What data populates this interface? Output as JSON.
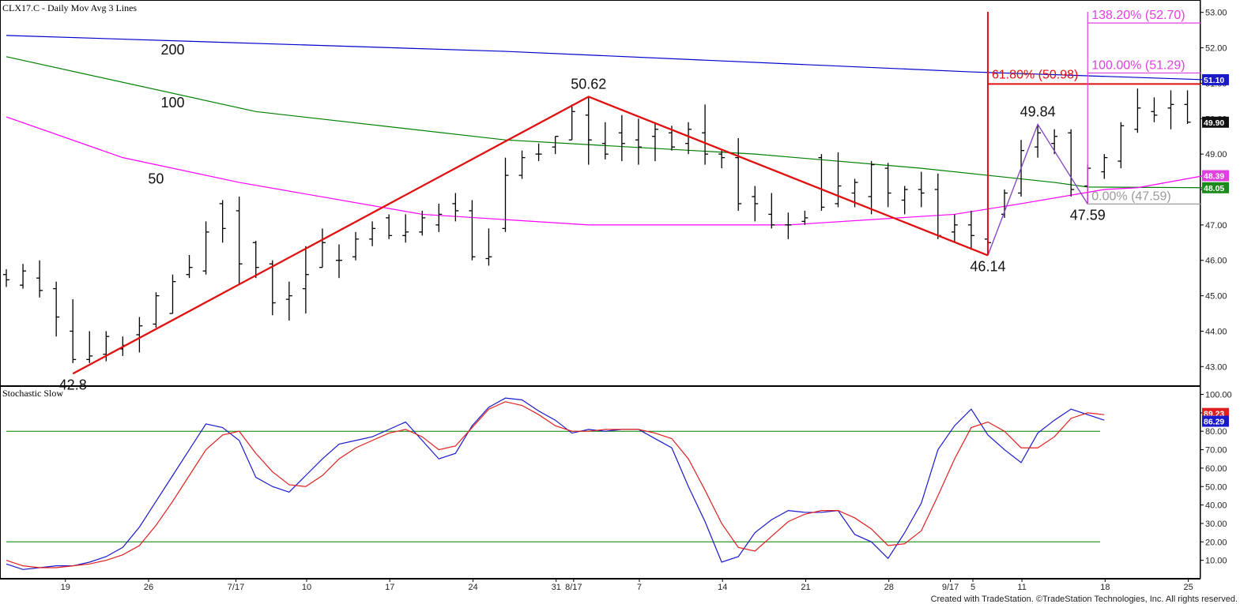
{
  "header": {
    "symbol_title": "CLX17.C - Daily  Mov Avg 3 Lines",
    "stoch_title": "Stochastic Slow",
    "credit": "Created with TradeStation. ©TradeStation Technologies, Inc. All rights reserved."
  },
  "chart_data": [
    {
      "type": "ohlc",
      "title": "CLX17.C - Daily  Mov Avg 3 Lines",
      "y_ticks": [
        "53.00",
        "52.00",
        "51.00",
        "50.00",
        "49.00",
        "48.00",
        "47.00",
        "46.00",
        "45.00",
        "44.00",
        "43.00"
      ],
      "ylim": [
        42.45,
        53.35
      ],
      "x_ticks": [
        "19",
        "26",
        "7/17",
        "10",
        "17",
        "24",
        "31",
        "8/17",
        "7",
        "14",
        "21",
        "28",
        "9/17",
        "5",
        "11",
        "18",
        "25"
      ],
      "bars": [
        {
          "h": 45.75,
          "l": 45.25,
          "o": 45.6,
          "c": 45.45
        },
        {
          "h": 45.9,
          "l": 45.2,
          "o": 45.3,
          "c": 45.7
        },
        {
          "h": 46.0,
          "l": 44.95,
          "o": 45.5,
          "c": 45.15
        },
        {
          "h": 45.4,
          "l": 43.85,
          "o": 45.2,
          "c": 44.4
        },
        {
          "h": 44.9,
          "l": 43.1,
          "o": 44.0,
          "c": 43.2
        },
        {
          "h": 44.0,
          "l": 43.1,
          "o": 43.2,
          "c": 43.3
        },
        {
          "h": 44.0,
          "l": 43.15,
          "o": 43.35,
          "c": 43.85
        },
        {
          "h": 43.85,
          "l": 43.3,
          "o": 43.5,
          "c": 43.6
        },
        {
          "h": 44.4,
          "l": 43.4,
          "o": 43.9,
          "c": 44.15
        },
        {
          "h": 45.1,
          "l": 44.1,
          "o": 44.2,
          "c": 45.0
        },
        {
          "h": 45.6,
          "l": 44.5,
          "o": 44.5,
          "c": 45.4
        },
        {
          "h": 46.15,
          "l": 45.5,
          "o": 45.6,
          "c": 45.8
        },
        {
          "h": 47.1,
          "l": 45.6,
          "o": 45.7,
          "c": 46.8
        },
        {
          "h": 47.7,
          "l": 46.5,
          "o": 47.6,
          "c": 46.9
        },
        {
          "h": 47.8,
          "l": 45.3,
          "o": 47.4,
          "c": 45.9
        },
        {
          "h": 46.55,
          "l": 45.5,
          "o": 46.5,
          "c": 45.8
        },
        {
          "h": 46.0,
          "l": 44.45,
          "o": 45.9,
          "c": 44.8
        },
        {
          "h": 45.4,
          "l": 44.3,
          "o": 44.9,
          "c": 45.0
        },
        {
          "h": 46.4,
          "l": 44.5,
          "o": 45.2,
          "c": 45.6
        },
        {
          "h": 46.9,
          "l": 45.8,
          "o": 45.8,
          "c": 46.5
        },
        {
          "h": 46.45,
          "l": 45.5,
          "o": 46.0,
          "c": 46.0
        },
        {
          "h": 46.8,
          "l": 46.0,
          "o": 46.1,
          "c": 46.6
        },
        {
          "h": 47.1,
          "l": 46.4,
          "o": 46.6,
          "c": 46.9
        },
        {
          "h": 47.3,
          "l": 46.6,
          "o": 47.2,
          "c": 46.7
        },
        {
          "h": 47.3,
          "l": 46.5,
          "o": 46.7,
          "c": 46.8
        },
        {
          "h": 47.4,
          "l": 46.7,
          "o": 46.8,
          "c": 47.2
        },
        {
          "h": 47.6,
          "l": 46.8,
          "o": 47.0,
          "c": 47.3
        },
        {
          "h": 47.9,
          "l": 47.1,
          "o": 47.6,
          "c": 47.4
        },
        {
          "h": 47.7,
          "l": 46.0,
          "o": 47.4,
          "c": 46.1
        },
        {
          "h": 46.9,
          "l": 45.85,
          "o": 46.05,
          "c": 46.1
        },
        {
          "h": 48.9,
          "l": 46.8,
          "o": 46.9,
          "c": 48.4
        },
        {
          "h": 49.1,
          "l": 48.3,
          "o": 48.4,
          "c": 48.9
        },
        {
          "h": 49.3,
          "l": 48.8,
          "o": 49.0,
          "c": 49.0
        },
        {
          "h": 49.5,
          "l": 49.0,
          "o": 49.2,
          "c": 49.5
        },
        {
          "h": 50.4,
          "l": 49.4,
          "o": 49.4,
          "c": 50.2
        },
        {
          "h": 50.62,
          "l": 48.7,
          "o": 50.1,
          "c": 49.4
        },
        {
          "h": 49.9,
          "l": 48.85,
          "o": 49.3,
          "c": 49.0
        },
        {
          "h": 50.1,
          "l": 48.8,
          "o": 49.6,
          "c": 49.3
        },
        {
          "h": 50.0,
          "l": 48.7,
          "o": 49.4,
          "c": 49.2
        },
        {
          "h": 49.9,
          "l": 48.8,
          "o": 49.5,
          "c": 49.7
        },
        {
          "h": 49.8,
          "l": 49.1,
          "o": 49.6,
          "c": 49.2
        },
        {
          "h": 49.9,
          "l": 49.0,
          "o": 49.3,
          "c": 49.7
        },
        {
          "h": 50.4,
          "l": 48.7,
          "o": 49.6,
          "c": 49.0
        },
        {
          "h": 49.1,
          "l": 48.6,
          "o": 49.0,
          "c": 48.9
        },
        {
          "h": 49.45,
          "l": 47.4,
          "o": 48.9,
          "c": 47.6
        },
        {
          "h": 48.1,
          "l": 47.1,
          "o": 47.8,
          "c": 47.6
        },
        {
          "h": 47.9,
          "l": 46.9,
          "o": 47.3,
          "c": 47.0
        },
        {
          "h": 47.35,
          "l": 46.6,
          "o": 47.0,
          "c": 47.0
        },
        {
          "h": 47.4,
          "l": 47.0,
          "o": 47.1,
          "c": 47.2
        },
        {
          "h": 49.0,
          "l": 47.4,
          "o": 48.9,
          "c": 47.5
        },
        {
          "h": 49.05,
          "l": 47.5,
          "o": 47.6,
          "c": 48.1
        },
        {
          "h": 48.3,
          "l": 47.5,
          "o": 47.9,
          "c": 48.2
        },
        {
          "h": 48.8,
          "l": 47.3,
          "o": 47.8,
          "c": 48.7
        },
        {
          "h": 48.75,
          "l": 47.5,
          "o": 48.6,
          "c": 47.9
        },
        {
          "h": 48.1,
          "l": 47.3,
          "o": 47.7,
          "c": 48.0
        },
        {
          "h": 48.5,
          "l": 47.5,
          "o": 48.0,
          "c": 47.9
        },
        {
          "h": 48.45,
          "l": 46.6,
          "o": 48.0,
          "c": 46.7
        },
        {
          "h": 47.3,
          "l": 46.5,
          "o": 46.8,
          "c": 47.0
        },
        {
          "h": 47.4,
          "l": 46.3,
          "o": 47.0,
          "c": 46.7
        },
        {
          "h": 47.0,
          "l": 46.14,
          "o": 46.6,
          "c": 46.5
        },
        {
          "h": 48.0,
          "l": 47.2,
          "o": 47.3,
          "c": 47.9
        },
        {
          "h": 49.4,
          "l": 47.8,
          "o": 47.9,
          "c": 49.1
        },
        {
          "h": 49.84,
          "l": 48.9,
          "o": 49.2,
          "c": 49.6
        },
        {
          "h": 49.7,
          "l": 49.0,
          "o": 49.3,
          "c": 49.5
        },
        {
          "h": 49.7,
          "l": 47.8,
          "o": 49.6,
          "c": 48.0
        },
        {
          "h": 48.7,
          "l": 47.59,
          "o": 48.1,
          "c": 48.6
        },
        {
          "h": 49.0,
          "l": 48.3,
          "o": 48.5,
          "c": 48.9
        },
        {
          "h": 49.9,
          "l": 48.6,
          "o": 48.8,
          "c": 49.8
        },
        {
          "h": 50.85,
          "l": 49.6,
          "o": 49.7,
          "c": 50.3
        },
        {
          "h": 50.6,
          "l": 49.9,
          "o": 50.2,
          "c": 50.1
        },
        {
          "h": 50.8,
          "l": 49.7,
          "o": 50.3,
          "c": 50.4
        },
        {
          "h": 50.8,
          "l": 49.85,
          "o": 50.4,
          "c": 49.9
        }
      ],
      "moving_averages": [
        {
          "name": "200",
          "color": "#0000cc",
          "points": [
            [
              0,
              52.35
            ],
            [
              30,
              51.9
            ],
            [
              58,
              51.32
            ],
            [
              72,
              51.1
            ]
          ]
        },
        {
          "name": "100",
          "color": "#008000",
          "points": [
            [
              0,
              51.75
            ],
            [
              15,
              50.2
            ],
            [
              30,
              49.4
            ],
            [
              45,
              49.0
            ],
            [
              55,
              48.6
            ],
            [
              63,
              48.2
            ],
            [
              65,
              48.07
            ],
            [
              72,
              48.05
            ]
          ]
        },
        {
          "name": "50",
          "color": "#ff00ff",
          "points": [
            [
              0,
              50.05
            ],
            [
              7,
              48.9
            ],
            [
              14,
              48.2
            ],
            [
              25,
              47.3
            ],
            [
              35,
              47.0
            ],
            [
              47,
              47.0
            ],
            [
              57,
              47.3
            ],
            [
              61,
              47.6
            ],
            [
              66,
              48.0
            ],
            [
              68,
              48.05
            ],
            [
              72,
              48.39
            ]
          ]
        }
      ],
      "swing_lines": [
        [
          4,
          42.8
        ],
        [
          35,
          50.62
        ],
        [
          59,
          46.14
        ]
      ],
      "abc_lines": [
        [
          59,
          46.14
        ],
        [
          62,
          49.84
        ],
        [
          65,
          47.59
        ]
      ],
      "swing_labels": [
        {
          "label": "42.8",
          "bar": 4,
          "value": 42.8,
          "pos": "below"
        },
        {
          "label": "50.62",
          "bar": 35,
          "value": 50.62,
          "pos": "above"
        },
        {
          "label": "46.14",
          "bar": 59,
          "value": 46.14,
          "pos": "below"
        },
        {
          "label": "49.84",
          "bar": 62,
          "value": 49.84,
          "pos": "above"
        },
        {
          "label": "47.59",
          "bar": 65,
          "value": 47.59,
          "pos": "below"
        }
      ],
      "ma_labels": [
        {
          "label": "200",
          "bar": 10,
          "value": 51.95
        },
        {
          "label": "100",
          "bar": 10,
          "value": 50.45
        },
        {
          "label": "50",
          "bar": 9,
          "value": 48.3
        }
      ],
      "retracement": {
        "label": "61.80% (50.98)",
        "level": 50.98,
        "bar": 59
      },
      "extensions": [
        {
          "label": "138.20% (52.70)",
          "level": 52.7
        },
        {
          "label": "100.00% (51.29)",
          "level": 51.29
        },
        {
          "label": "0.00% (47.59)",
          "level": 47.59
        }
      ],
      "price_tags": [
        {
          "label": "51.10",
          "value": 51.1,
          "color": "#1a1acc"
        },
        {
          "label": "49.90",
          "value": 49.9,
          "color": "#111111"
        },
        {
          "label": "48.39",
          "value": 48.39,
          "color": "#e040e0"
        },
        {
          "label": "48.05",
          "value": 48.05,
          "color": "#1a8a1a"
        }
      ]
    },
    {
      "type": "line",
      "title": "Stochastic Slow",
      "y_ticks": [
        "100.00",
        "90.00",
        "80.00",
        "70.00",
        "60.00",
        "50.00",
        "40.00",
        "30.00",
        "20.00",
        "10.00"
      ],
      "ylim": [
        0,
        104.5
      ],
      "levels": [
        80,
        20
      ],
      "series": [
        {
          "name": "",
          "color": "#1a1acc",
          "values": [
            8,
            5,
            6,
            7,
            7,
            9,
            12,
            17,
            28,
            42,
            56,
            70,
            84,
            82,
            75,
            55,
            50,
            47,
            56,
            65,
            73,
            75,
            77,
            81,
            85,
            75,
            65,
            68,
            83,
            93,
            98,
            97,
            91,
            86,
            79,
            81,
            80,
            81,
            81,
            76,
            71,
            50,
            31,
            9,
            12,
            25,
            32,
            37,
            36,
            36,
            37,
            24,
            20,
            11,
            25,
            41,
            70,
            83,
            92,
            78,
            70,
            63,
            79,
            86,
            92,
            89,
            86
          ]
        },
        {
          "name": "",
          "color": "#e02020",
          "values": [
            10,
            7,
            6,
            6,
            7,
            8,
            10,
            13,
            18,
            29,
            42,
            56,
            70,
            78,
            80,
            68,
            58,
            51,
            50,
            56,
            65,
            71,
            75,
            79,
            81,
            77,
            70,
            72,
            82,
            92,
            96,
            94,
            89,
            83,
            80,
            80,
            81,
            81,
            81,
            79,
            76,
            65,
            48,
            30,
            17,
            15,
            23,
            31,
            35,
            37,
            37,
            33,
            27,
            18,
            19,
            26,
            45,
            65,
            82,
            85,
            80,
            71,
            71,
            77,
            87,
            90,
            89
          ]
        }
      ],
      "value_tags": [
        {
          "label": "89.23",
          "value": 89.23,
          "color": "#e02020"
        },
        {
          "label": "86.29",
          "value": 86.29,
          "color": "#1a1acc"
        }
      ]
    }
  ]
}
